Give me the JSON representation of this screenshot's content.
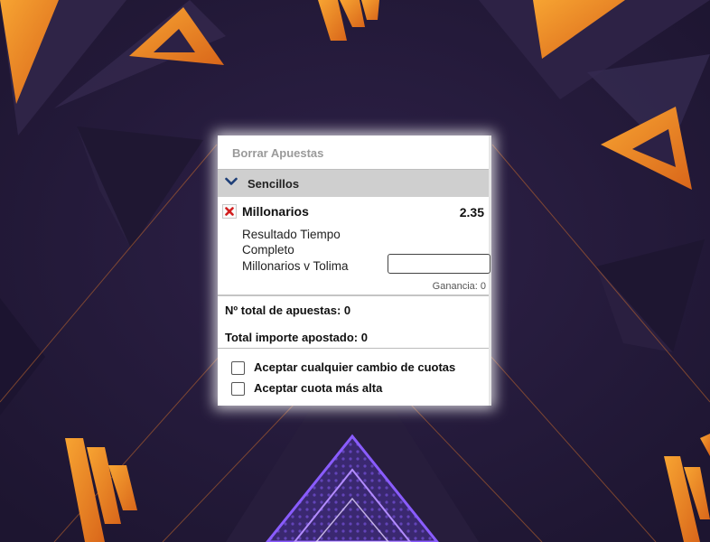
{
  "bet_slip": {
    "clear_bets": "Borrar Apuestas",
    "section_title": "Sencillos",
    "selection": {
      "team": "Millonarios",
      "odds": "2.35",
      "market": "Resultado Tiempo Completo",
      "event": "Millonarios v Tolima",
      "stake_value": "",
      "winnings": "Ganancia: 0"
    },
    "total_bets": "Nº total de apuestas: 0",
    "total_stake": "Total importe apostado:  0",
    "options": {
      "accept_any_odds_change": "Aceptar cualquier cambio de cuotas",
      "accept_higher_odds": "Aceptar cuota más alta"
    }
  },
  "icons": [
    "chevron-down-icon",
    "close-icon",
    "logo-w-icon",
    "triangle-icon"
  ],
  "colors": {
    "background": "#241a3a",
    "accent_orange": "#f28a1e",
    "accent_purple": "#7b4fe0",
    "remove_red": "#d21f1f",
    "chevron_blue": "#1e3f78"
  }
}
